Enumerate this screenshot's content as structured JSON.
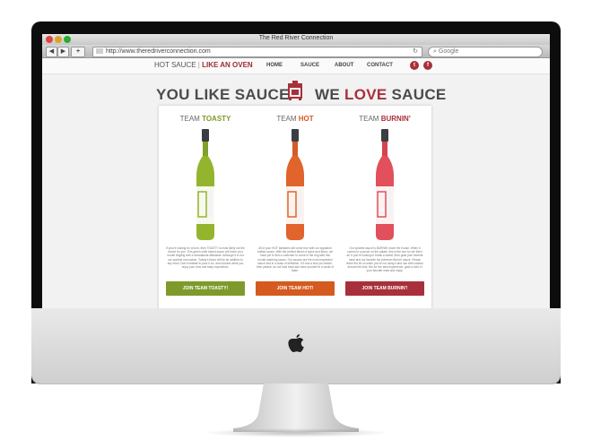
{
  "browser": {
    "window_title": "The Red River Connection",
    "back_label": "◀",
    "forward_label": "▶",
    "add_label": "+",
    "url": "http://www.theredriverconnection.com",
    "search_placeholder": "Google"
  },
  "site": {
    "brand_prefix": "HOT SAUCE",
    "brand_strong": "LIKE AN OVEN",
    "nav": [
      "HOME",
      "SAUCE",
      "ABOUT",
      "CONTACT"
    ],
    "social": {
      "twitter": "t",
      "facebook": "f"
    },
    "headline_left": "YOU LIKE SAUCE",
    "headline_right_a": "WE",
    "headline_right_love": "LOVE",
    "headline_right_b": "SAUCE",
    "accent_color": "#a8303a"
  },
  "teams": [
    {
      "prefix": "TEAM",
      "name": "TOASTY",
      "color": "#7f9a2b",
      "bottle_color": "#93b52e",
      "description": "If you're looking for a burn, then TOASTY is most likely not the choice for you. This green chile based sauce will leave your mouth tingling with a sensational aftertaste. Although it is not our spiciest concoction, Toasty's flavor will be an addition to any meal. Don't hesitate to pour it on, and sit back while you enjoy your new and tasty experience.",
      "button": "JOIN TEAM TOASTY!"
    },
    {
      "prefix": "TEAM",
      "name": "HOT",
      "color": "#d45a1f",
      "bottle_color": "#e0642b",
      "description": "All of your HOT fantasies will come true with our signature buffalo sauce. With the perfect blend of spice and flavor, we have yet to find a customer to come in the ring with this mouth-watering sauce. Our sauces are the most requested sauce and in a class of definition. If it has a kick you desire, then please, do not hold back and have yourself in a world of taste.",
      "button": "JOIN TEAM HOT!"
    },
    {
      "prefix": "TEAM",
      "name": "BURNIN'",
      "color": "#a8303a",
      "bottle_color": "#e1505b",
      "description": "Our spiciest sauce is BURNIN' down the house. When it comes to a punch on the palate, this is the one to rule them all. If you're looking to break a sweat, then grab your favorite meal and our favorite hot premium Burnin' sauce. Please leave the lid on when you're not using it and use with caution around the kids. But for the best experience, grab a hold of your favorite meal and enjoy.",
      "button": "JOIN TEAM BURNIN'!"
    }
  ]
}
